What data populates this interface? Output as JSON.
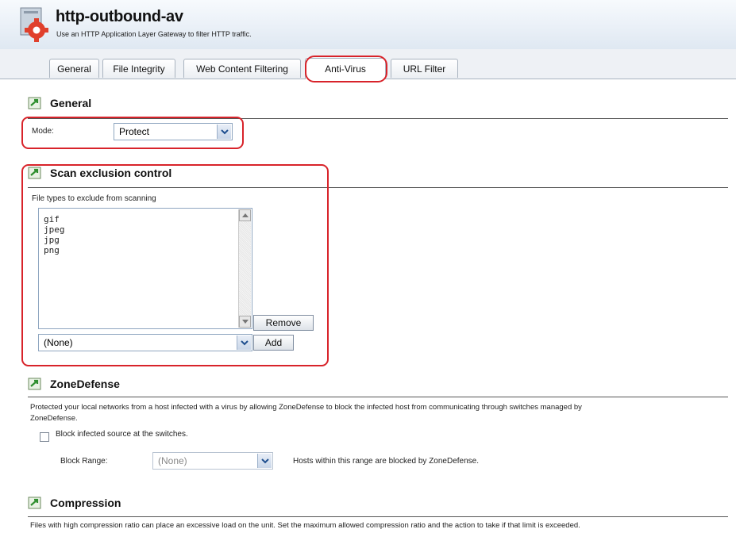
{
  "header": {
    "title": "http-outbound-av",
    "subtitle": "Use an HTTP Application Layer Gateway to filter HTTP traffic."
  },
  "tabs": [
    {
      "label": "General",
      "active": false
    },
    {
      "label": "File Integrity",
      "active": false
    },
    {
      "label": "Web Content Filtering",
      "active": false
    },
    {
      "label": "Anti-Virus",
      "active": true
    },
    {
      "label": "URL Filter",
      "active": false
    }
  ],
  "general": {
    "title": "General",
    "mode_label": "Mode:",
    "mode_value": "Protect"
  },
  "scan_exclusion": {
    "title": "Scan exclusion control",
    "list_label": "File types to exclude from scanning",
    "items": [
      "gif",
      "jpeg",
      "jpg",
      "png"
    ],
    "remove_label": "Remove",
    "select_value": "(None)",
    "add_label": "Add"
  },
  "zone_defense": {
    "title": "ZoneDefense",
    "description_line1": "Protected your local networks from a host infected with a virus by allowing ZoneDefense to block the infected host from communicating through switches managed by",
    "description_line2": "ZoneDefense.",
    "checkbox_label": "Block infected source at the switches.",
    "block_range_label": "Block Range:",
    "block_range_value": "(None)",
    "block_range_hint": "Hosts within this range are blocked by ZoneDefense."
  },
  "compression": {
    "title": "Compression",
    "description": "Files with high compression ratio can place an excessive load on the unit. Set the maximum allowed compression ratio and the action to take if that limit is exceeded."
  },
  "colors": {
    "highlight": "#d8232a",
    "section_icon": "#2f8f2f"
  }
}
